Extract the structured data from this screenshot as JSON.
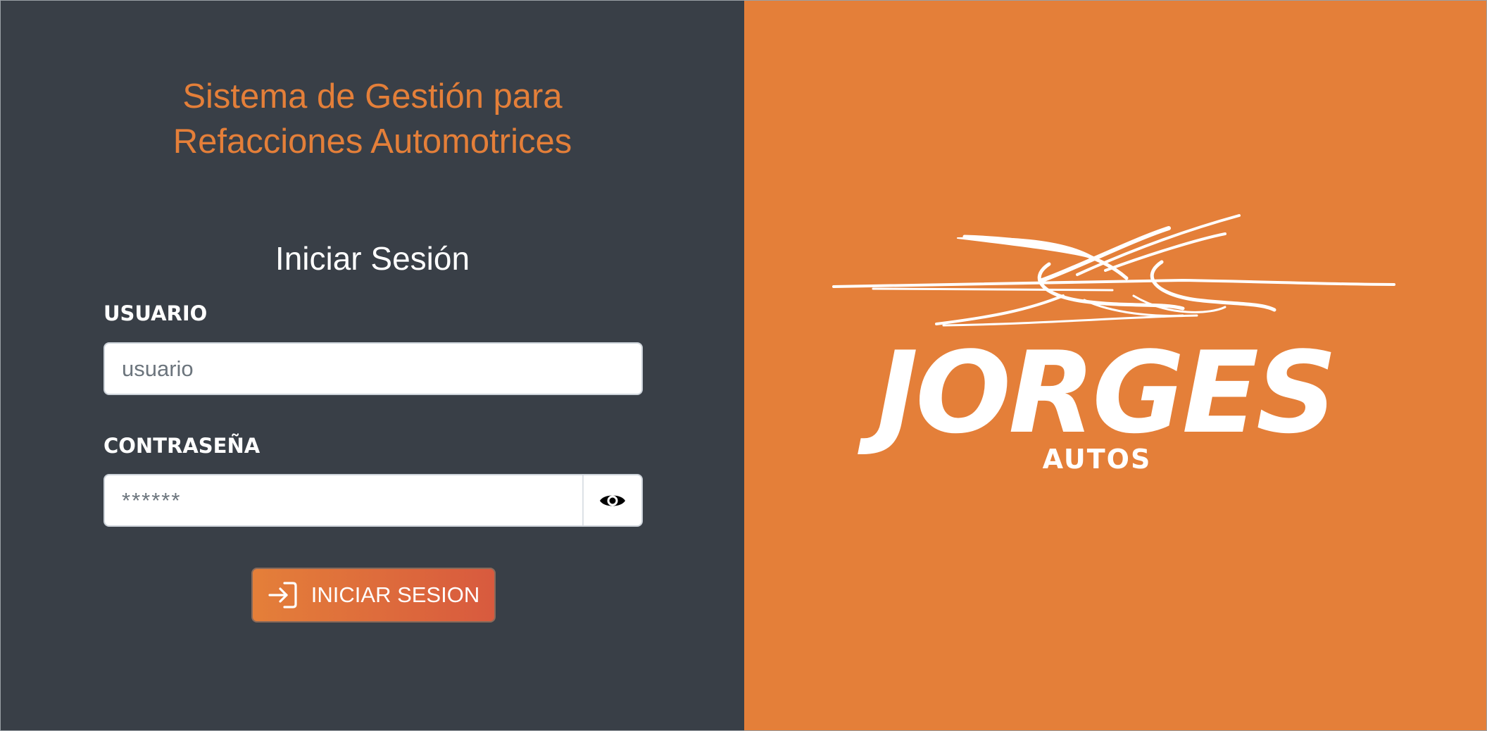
{
  "app": {
    "title_line1": "Sistema de Gestión para",
    "title_line2": "Refacciones Automotrices"
  },
  "login_form": {
    "heading": "Iniciar Sesión",
    "username_label": "USUARIO",
    "username_placeholder": "usuario",
    "username_value": "",
    "password_label": "CONTRASEÑA",
    "password_placeholder": "******",
    "password_value": "",
    "password_toggle_icon": "eye-icon",
    "submit_icon": "sign-in-icon",
    "submit_label": "INICIAR SESION"
  },
  "brand": {
    "name": "JORGES",
    "subtitle": "AUTOS"
  },
  "colors": {
    "left_panel_bg": "#393f47",
    "right_panel_bg": "#e47f39",
    "accent": "#e47f39",
    "button_gradient_start": "#e47f39",
    "button_gradient_end": "#d85a3e"
  }
}
